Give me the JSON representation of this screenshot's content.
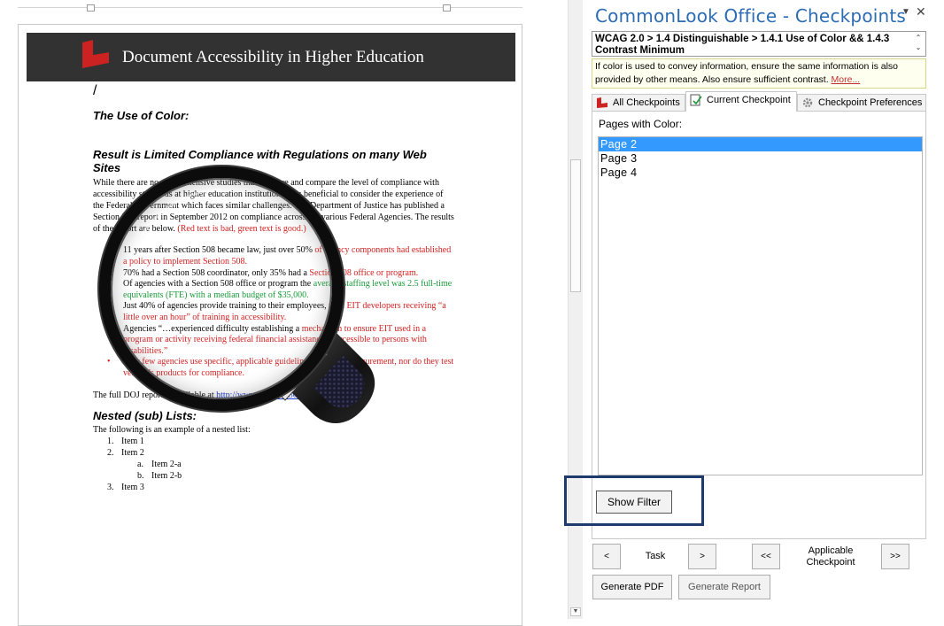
{
  "document": {
    "banner_title": "Document Accessibility in Higher Education",
    "cursor_char": "/",
    "heading_color": "The Use of Color:",
    "heading_result": "Result is Limited Compliance with Regulations on many Web Sites",
    "intro_paragraph": "While there are no comprehensive studies that measure and compare the level of compliance with accessibility standards at higher education institutions, it is beneficial to consider the experience of the Federal Government which faces similar challenges. The Department of Justice has published a Section 508 report in September 2012 on compliance across the various Federal Agencies. The results of the report are below.",
    "intro_red_note": "(Red text is bad, green text is good.)",
    "bullets": [
      {
        "color": "mixed",
        "before": "11 years after Section 508 became law, just over 50% ",
        "red": "of agency components had established a policy to implement Section 508."
      },
      {
        "color": "mixed",
        "before": "70% had a Section 508 coordinator, only 35% had a ",
        "red": "Section 508 office or program."
      },
      {
        "color": "mixed",
        "before": "Of agencies with a Section 508 office or program the ",
        "green": "average staffing level was 2.5 full-time equivalents (FTE) with a median budget of $35,000."
      },
      {
        "color": "mixed",
        "before": "Just 40% of agencies provide training to their employees, ",
        "red": "with EIT developers receiving “a little over an hour” of training in accessibility."
      },
      {
        "color": "mixed",
        "before": "Agencies “…experienced difficulty establishing a ",
        "red": "mechanism to ensure EIT used in a program or activity receiving federal financial assistance is accessible to persons with disabilities.”"
      },
      {
        "color": "red",
        "text": "Very few agencies use specific, applicable guidelines regarding procurement, nor do they test vendor’s products for compliance."
      }
    ],
    "full_report_prefix": "The full DOJ report is available at ",
    "full_report_link": "http://www.ada.gov/508/508_Report.htm",
    "full_report_suffix": ".",
    "heading_nested": "Nested (sub) Lists:",
    "nested_intro": "The following is an example of a nested list:",
    "nested_items": [
      {
        "num": "1.",
        "label": "Item 1"
      },
      {
        "num": "2.",
        "label": "Item 2",
        "sub": [
          {
            "num": "a.",
            "label": "Item 2-a"
          },
          {
            "num": "b.",
            "label": "Item 2-b"
          }
        ]
      },
      {
        "num": "3.",
        "label": "Item 3"
      }
    ]
  },
  "panel": {
    "title": "CommonLook Office - Checkpoints",
    "dropdown_icon": "dropdown-triangle-icon",
    "close_icon": "close-icon",
    "checkpoint_path": "WCAG 2.0 > 1.4 Distinguishable > 1.4.1 Use of Color && 1.4.3 Contrast Minimum",
    "description": "If color is used to convey information, ensure the same information is also provided by other means. Also ensure sufficient contrast.",
    "more_link": "More...",
    "tabs": [
      {
        "label": "All Checkpoints",
        "icon": "commonlook-logo-icon"
      },
      {
        "label": "Current Checkpoint",
        "icon": "document-check-icon"
      },
      {
        "label": "Checkpoint Preferences",
        "icon": "gear-icon"
      }
    ],
    "pages_label": "Pages with Color:",
    "pages": [
      "Page 2",
      "Page 3",
      "Page 4"
    ],
    "selected_page": "Page 2",
    "show_filter": "Show Filter",
    "nav": {
      "prev_task": "<",
      "task_label": "Task",
      "next_task": ">",
      "prev_checkpoint": "<<",
      "checkpoint_label": "Applicable Checkpoint",
      "next_checkpoint": ">>"
    },
    "generate_pdf": "Generate PDF",
    "generate_report": "Generate Report"
  },
  "colors": {
    "panel_title": "#2b6cb4",
    "banner_bg": "#323232",
    "logo_red": "#cc2222",
    "selection": "#3399ff",
    "highlight_frame": "#1f3a6c",
    "bad_text": "#d42020",
    "good_text": "#1a9a3a"
  }
}
